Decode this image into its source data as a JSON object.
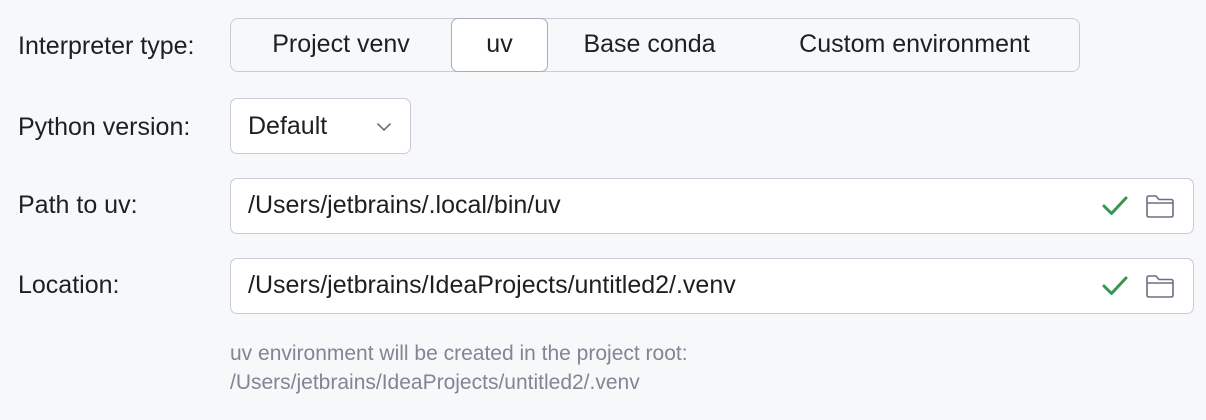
{
  "interpreter_type": {
    "label": "Interpreter type:",
    "options": [
      "Project venv",
      "uv",
      "Base conda",
      "Custom environment"
    ],
    "selected": "uv"
  },
  "python_version": {
    "label": "Python version:",
    "value": "Default",
    "arrow_icon": "chevron-down-icon"
  },
  "path_to_uv": {
    "label": "Path to uv:",
    "value": "/Users/jetbrains/.local/bin/uv",
    "status_icon": "check-icon",
    "browse_icon": "folder-icon"
  },
  "location": {
    "label": "Location:",
    "value": "/Users/jetbrains/IdeaProjects/untitled2/.venv",
    "status_icon": "check-icon",
    "browse_icon": "folder-icon"
  },
  "hint": {
    "line1": "uv environment will be created in the project root:",
    "line2": "/Users/jetbrains/IdeaProjects/untitled2/.venv"
  },
  "colors": {
    "background": "#f7f8fa",
    "border": "#c9ccd6",
    "selected_border": "#a8adbd",
    "valid_check": "#369650",
    "hint_text": "#818594",
    "icon_gray": "#6c707e"
  }
}
